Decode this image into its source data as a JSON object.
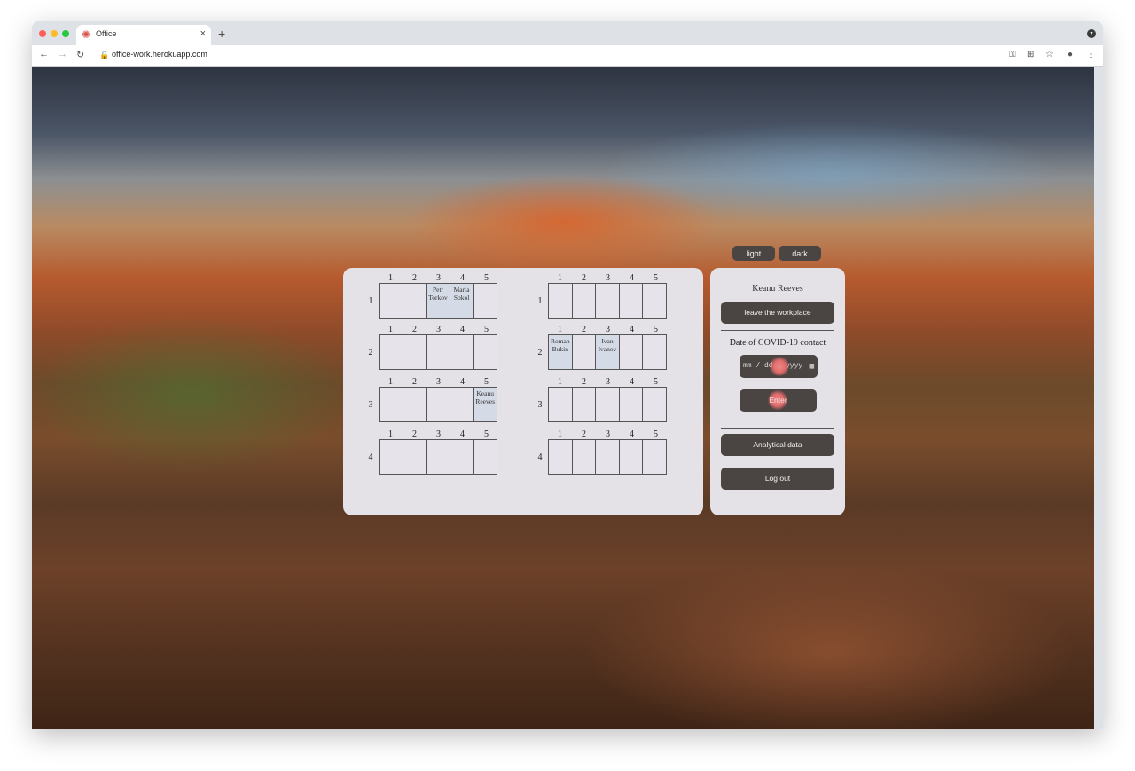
{
  "browser": {
    "tab_title": "Office",
    "tab_icon": "virus-icon",
    "new_tab_label": "+",
    "close_tab_label": "×",
    "url": "office-work.herokuapp.com"
  },
  "theme": {
    "light_label": "light",
    "dark_label": "dark"
  },
  "floors": [
    {
      "rows": [
        {
          "label": "1",
          "seats": [
            "",
            "",
            "Petr Torkov",
            "Maria Sokol",
            ""
          ]
        },
        {
          "label": "2",
          "seats": [
            "",
            "",
            "",
            "",
            ""
          ]
        },
        {
          "label": "3",
          "seats": [
            "",
            "",
            "",
            "",
            "Keanu Reeves"
          ]
        },
        {
          "label": "4",
          "seats": [
            "",
            "",
            "",
            "",
            ""
          ]
        }
      ]
    },
    {
      "rows": [
        {
          "label": "1",
          "seats": [
            "",
            "",
            "",
            "",
            ""
          ]
        },
        {
          "label": "2",
          "seats": [
            "Roman Bukin",
            "",
            "Ivan Ivanov",
            "",
            ""
          ]
        },
        {
          "label": "3",
          "seats": [
            "",
            "",
            "",
            "",
            ""
          ]
        },
        {
          "label": "4",
          "seats": [
            "",
            "",
            "",
            "",
            ""
          ]
        }
      ]
    }
  ],
  "column_labels": [
    "1",
    "2",
    "3",
    "4",
    "5"
  ],
  "sidebar": {
    "user_name": "Keanu Reeves",
    "leave_label": "leave the workplace",
    "covid_label": "Date of COVID-19 contact",
    "date_placeholder": "mm / dd / yyyy",
    "enter_label": "Enter",
    "analytics_label": "Analytical data",
    "logout_label": "Log out"
  }
}
